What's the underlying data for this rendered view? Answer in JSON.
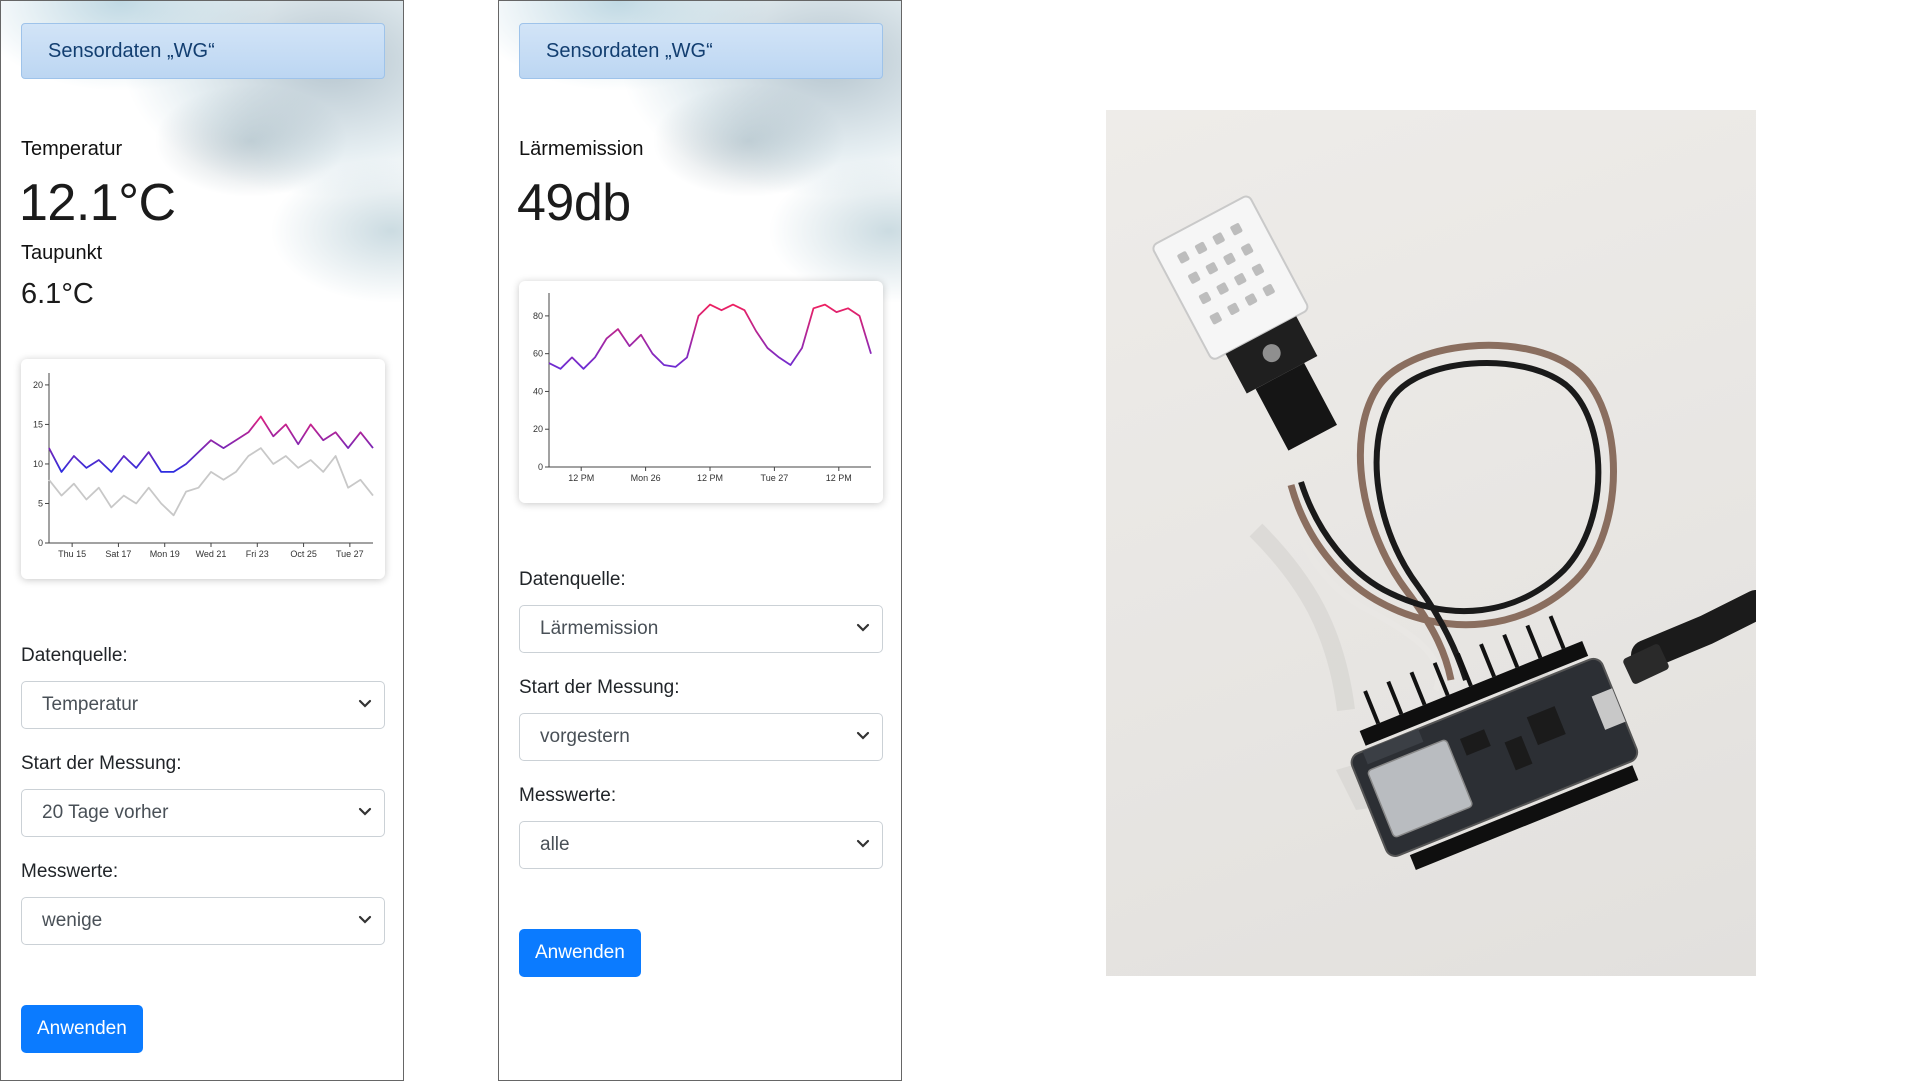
{
  "panels": [
    {
      "brand": "Sensordaten „WG“",
      "metric_label": "Temperatur",
      "metric_value": "12.1°C",
      "secondary_label": "Taupunkt",
      "secondary_value": "6.1°C",
      "form": {
        "source_label": "Datenquelle:",
        "source_value": "Temperatur",
        "start_label": "Start der Messung:",
        "start_value": "20 Tage vorher",
        "values_label": "Messwerte:",
        "values_value": "wenige",
        "apply_label": "Anwenden"
      }
    },
    {
      "brand": "Sensordaten „WG“",
      "metric_label": "Lärmemission",
      "metric_value": "49db",
      "form": {
        "source_label": "Datenquelle:",
        "source_value": "Lärmemission",
        "start_label": "Start der Messung:",
        "start_value": "vorgestern",
        "values_label": "Messwerte:",
        "values_value": "alle",
        "apply_label": "Anwenden"
      }
    }
  ],
  "chart_data": [
    {
      "type": "line",
      "x_ticks": [
        "Thu 15",
        "Sat 17",
        "Mon 19",
        "Wed 21",
        "Fri 23",
        "Oct 25",
        "Tue 27"
      ],
      "y_ticks": [
        0,
        5,
        10,
        15,
        20
      ],
      "ylim": [
        0,
        21
      ],
      "x": [
        0,
        0.5,
        1,
        1.5,
        2,
        2.5,
        3,
        3.5,
        4,
        4.5,
        5,
        5.5,
        6,
        6.5,
        7,
        7.5,
        8,
        8.5,
        9,
        9.5,
        10,
        10.5,
        11,
        11.5,
        12,
        12.5,
        13
      ],
      "series": [
        {
          "values": [
            12,
            9,
            11,
            9.5,
            10.5,
            9,
            11,
            9.5,
            11.5,
            9,
            9,
            10,
            11.5,
            13,
            12,
            13,
            14,
            16,
            13.5,
            15,
            12.5,
            15,
            13,
            14,
            12,
            14,
            12
          ],
          "color_gradient": [
            "#2c2ce0",
            "#e0207e"
          ]
        },
        {
          "values": [
            8,
            6,
            7.5,
            5.5,
            7,
            4.5,
            6,
            5,
            7,
            5,
            3.5,
            6.5,
            7,
            9,
            8,
            9,
            11,
            12,
            10,
            11,
            9.5,
            10.5,
            9,
            11,
            7,
            8,
            6
          ],
          "color": "#c8c8c8"
        }
      ]
    },
    {
      "type": "line",
      "x_ticks": [
        "12 PM",
        "Mon 26",
        "12 PM",
        "Tue 27",
        "12 PM"
      ],
      "y_ticks": [
        0,
        20,
        40,
        60,
        80
      ],
      "ylim": [
        0,
        90
      ],
      "x": [
        0,
        0.5,
        1,
        1.5,
        2,
        2.5,
        3,
        3.5,
        4,
        4.5,
        5,
        5.5,
        6,
        6.5,
        7,
        7.5,
        8,
        8.5,
        9,
        9.5,
        10,
        10.5,
        11,
        11.5,
        12,
        12.5,
        13,
        13.5,
        14
      ],
      "series": [
        {
          "values": [
            55,
            52,
            58,
            52,
            58,
            68,
            73,
            64,
            70,
            60,
            54,
            53,
            58,
            80,
            86,
            83,
            86,
            83,
            72,
            63,
            58,
            54,
            63,
            84,
            86,
            82,
            84,
            80,
            60
          ],
          "color_gradient": [
            "#6a2cd6",
            "#ee2060"
          ]
        }
      ]
    }
  ],
  "photo": {
    "description_icon": "esp8266-dht22-sensor-photo",
    "colors": {
      "background": "#ebe9e6",
      "board": "#2c2f34",
      "sensor": "#f4f4f4",
      "cable_brown": "#8a6e5f",
      "cable_black": "#1a1a1a"
    }
  }
}
